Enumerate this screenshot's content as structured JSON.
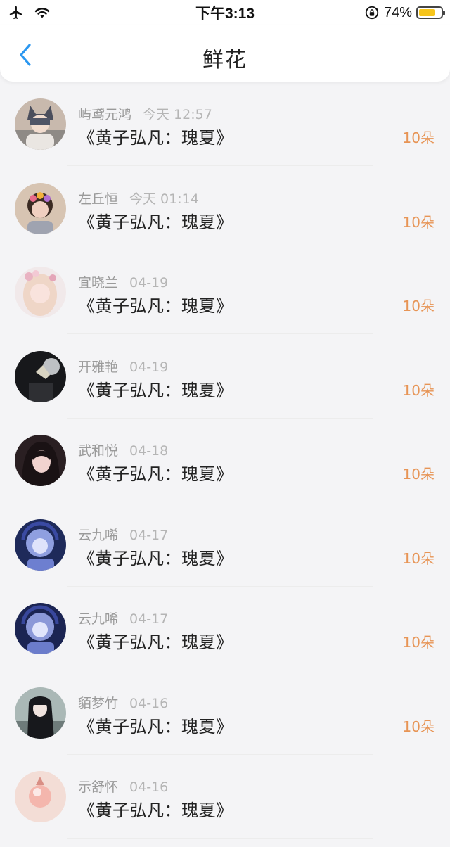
{
  "status_bar": {
    "time": "下午3:13",
    "battery_percent_label": "74%",
    "battery_level": 0.74,
    "icons": [
      "airplane-icon",
      "wifi-icon",
      "rotation-lock-icon",
      "battery-icon"
    ]
  },
  "nav": {
    "title": "鲜花",
    "back_icon": "chevron-left-icon"
  },
  "colors": {
    "accent_blue": "#2b97f0",
    "count_orange": "#e79455",
    "battery_yellow": "#f7c51b"
  },
  "items": [
    {
      "name": "屿鸢元鸿",
      "time": "今天 12:57",
      "book": "《黄子弘凡：瑰夏》",
      "count": "10朵"
    },
    {
      "name": "左丘恒",
      "time": "今天 01:14",
      "book": "《黄子弘凡：瑰夏》",
      "count": "10朵"
    },
    {
      "name": "宜晓兰",
      "time": "04-19",
      "book": "《黄子弘凡：瑰夏》",
      "count": "10朵"
    },
    {
      "name": "开雅艳",
      "time": "04-19",
      "book": "《黄子弘凡：瑰夏》",
      "count": "10朵"
    },
    {
      "name": "武和悦",
      "time": "04-18",
      "book": "《黄子弘凡：瑰夏》",
      "count": "10朵"
    },
    {
      "name": "云九唏",
      "time": "04-17",
      "book": "《黄子弘凡：瑰夏》",
      "count": "10朵"
    },
    {
      "name": "云九唏",
      "time": "04-17",
      "book": "《黄子弘凡：瑰夏》",
      "count": "10朵"
    },
    {
      "name": "貊梦竹",
      "time": "04-16",
      "book": "《黄子弘凡：瑰夏》",
      "count": "10朵"
    },
    {
      "name": "示舒怀",
      "time": "04-16",
      "book": "《黄子弘凡：瑰夏》",
      "count": ""
    }
  ]
}
